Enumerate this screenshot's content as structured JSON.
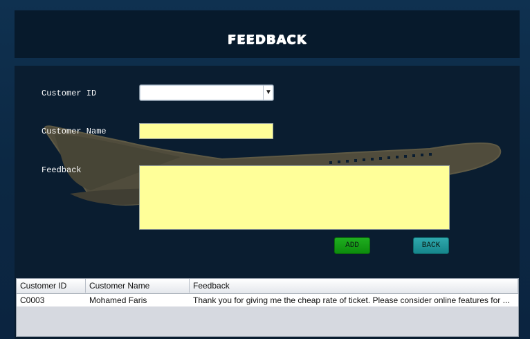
{
  "header": {
    "title": "FEEDBACK"
  },
  "form": {
    "customer_id_label": "Customer ID",
    "customer_id_value": "",
    "customer_name_label": "Customer Name",
    "customer_name_value": "",
    "feedback_label": "Feedback",
    "feedback_value": ""
  },
  "buttons": {
    "add": "ADD",
    "back": "BACK"
  },
  "table": {
    "columns": [
      "Customer ID",
      "Customer Name",
      "Feedback"
    ],
    "rows": [
      [
        "C0003",
        "Mohamed Faris",
        "Thank you for giving me the cheap rate of ticket. Please consider online features for ..."
      ]
    ]
  },
  "icons": {
    "dropdown": "chevron-down-icon",
    "background": "airplane-icon"
  },
  "colors": {
    "header_bg": "#071a2c",
    "panel_bg": "#0a1d30",
    "field_bg": "#ffff99",
    "add_button": "#0d8c0d",
    "back_button": "#16868c"
  }
}
